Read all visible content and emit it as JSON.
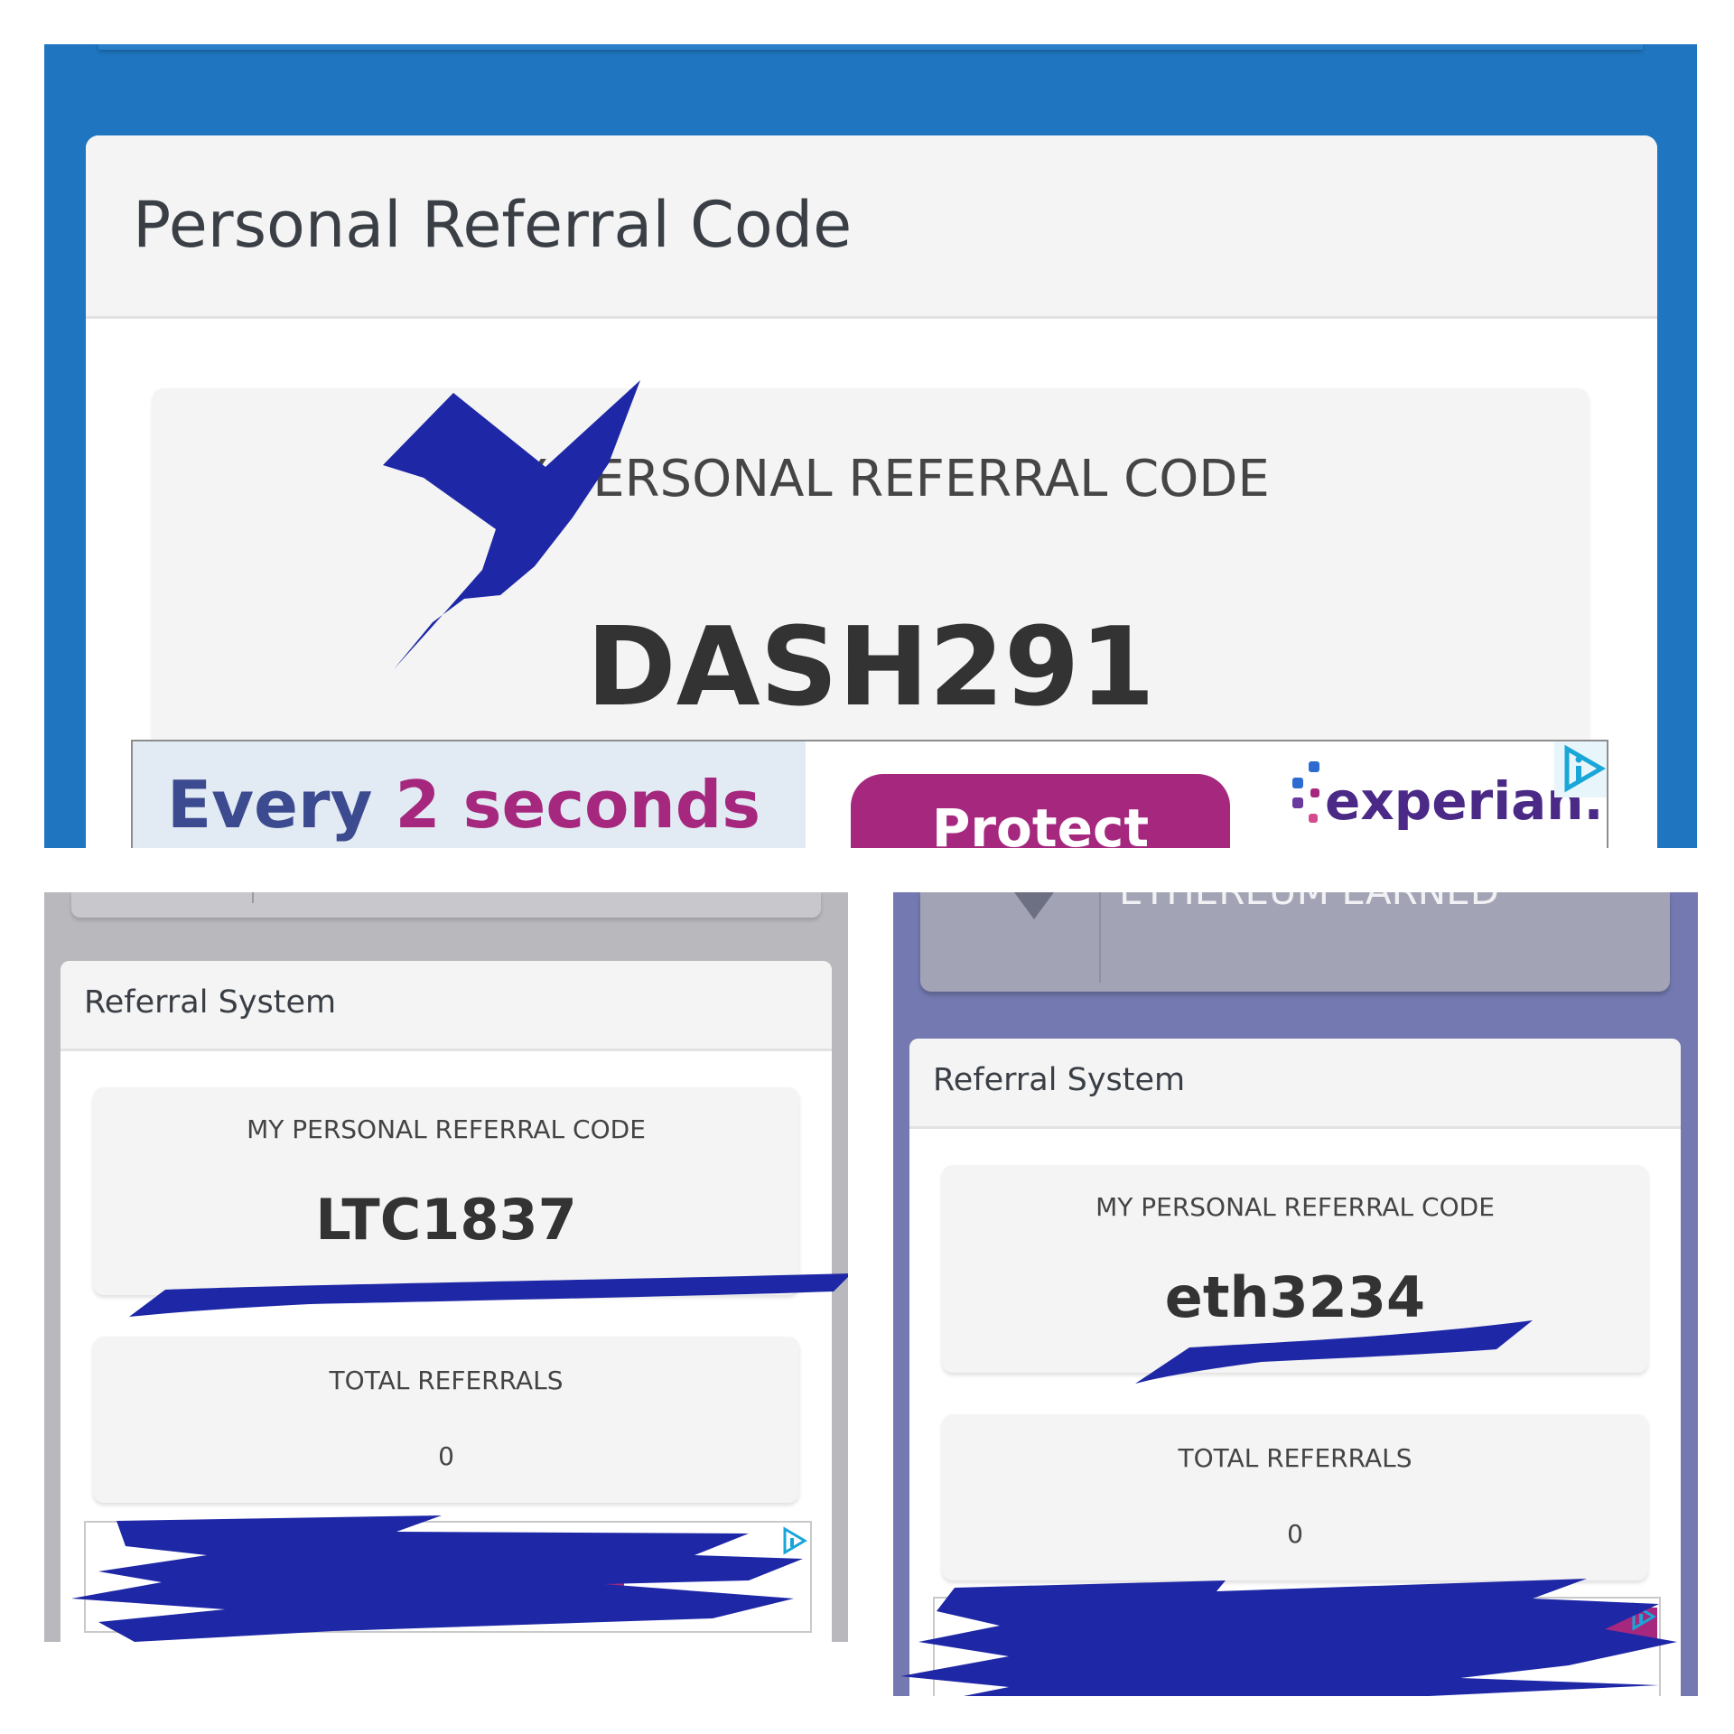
{
  "top_panel": {
    "header_title": "Personal Referral Code",
    "box_label": "MY PERSONAL REFERRAL CODE",
    "code": "DASH291",
    "ad": {
      "headline_part1": "Every",
      "headline_part2": "2 seconds",
      "cta_label": "Protect",
      "brand": "experian."
    },
    "colors": {
      "background": "#1f75bf",
      "scribble": "#1e27a6",
      "ad_accent": "#a5287e"
    }
  },
  "bottom_left_panel": {
    "header_title": "Referral System",
    "code_label": "MY PERSONAL REFERRAL CODE",
    "code": "LTC1837",
    "referrals_label": "TOTAL REFERRALS",
    "referrals_count": "0",
    "colors": {
      "background": "#b8b8bd"
    }
  },
  "bottom_right_panel": {
    "top_strip_text": "ETHEREUM EARNED",
    "header_title": "Referral System",
    "code_label": "MY PERSONAL REFERRAL CODE",
    "code": "eth3234",
    "referrals_label": "TOTAL REFERRALS",
    "referrals_count": "0",
    "colors": {
      "background": "#7479b1"
    }
  },
  "icons": [
    "adchoices-icon",
    "chevron-down-icon"
  ]
}
